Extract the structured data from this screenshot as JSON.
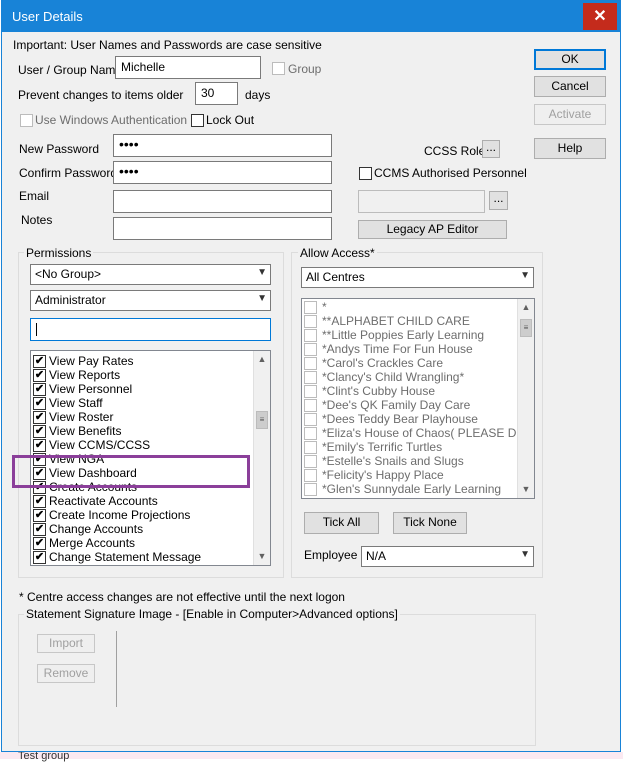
{
  "background": {
    "top_text": "",
    "bottom_text": "Test group"
  },
  "window": {
    "title": "User Details"
  },
  "header": {
    "important": "Important:  User Names and Passwords are case sensitive"
  },
  "fields": {
    "username_label": "User / Group Name",
    "username_value": "Michelle",
    "group_label": "Group",
    "prevent_label": "Prevent changes to items older",
    "prevent_value": "30",
    "days_label": "days",
    "windows_auth_label": "Use Windows Authentication",
    "lockout_label": "Lock Out",
    "new_password_label": "New Password",
    "new_password_value": "••••",
    "confirm_password_label": "Confirm Password",
    "confirm_password_value": "••••",
    "email_label": "Email",
    "email_value": "",
    "notes_label": "Notes",
    "notes_value": ""
  },
  "ccss": {
    "role_label": "CCSS Role",
    "role_btn": "...",
    "ccms_label": "CCMS Authorised Personnel",
    "browse_btn": "...",
    "legacy_btn": "Legacy AP Editor"
  },
  "buttons": {
    "ok": "OK",
    "cancel": "Cancel",
    "activate": "Activate",
    "help": "Help"
  },
  "permissions": {
    "title": "Permissions",
    "group_combo": "<No Group>",
    "role_combo": "Administrator",
    "search_value": "",
    "items": [
      "View Pay Rates",
      "View Reports",
      "View Personnel",
      "View Staff",
      "View Roster",
      "View Benefits",
      "View CCMS/CCSS",
      "View NGA",
      "View Dashboard",
      "Create Accounts",
      "Reactivate Accounts",
      "Create Income Projections",
      "Change Accounts",
      "Merge Accounts",
      "Change Statement Message"
    ]
  },
  "access": {
    "title": "Allow Access*",
    "centres_combo": "All Centres",
    "items": [
      "*",
      "**ALPHABET CHILD CARE",
      "**Little Poppies Early Learning",
      "*Andys Time For Fun House",
      "*Carol's Crackles Care",
      "*Clancy's Child Wrangling*",
      "*Clint's Cubby House",
      "*Dee's QK Family Day Care",
      "*Dees Teddy Bear Playhouse",
      "*Eliza's House of Chaos( PLEASE DO NOT",
      "*Emily's Terrific Turtles",
      "*Estelle's Snails and Slugs",
      "*Felicity's Happy Place",
      "*Glen's Sunnydale Early Learning"
    ],
    "tick_all": "Tick All",
    "tick_none": "Tick None",
    "employee_label": "Employee",
    "employee_value": "N/A"
  },
  "footer": {
    "note": "* Centre access changes are not effective until the next logon",
    "signature_title": "Statement Signature Image - [Enable in Computer>Advanced options]",
    "import_btn": "Import",
    "remove_btn": "Remove"
  },
  "colors": {
    "titlebar": "#1883d7",
    "close": "#c42b1c",
    "highlight": "#8b3f9a"
  }
}
